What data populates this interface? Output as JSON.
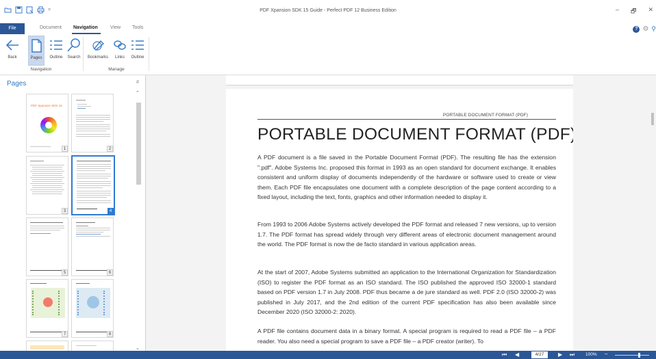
{
  "window": {
    "title": "PDF Xpansion SDK 15 Guide - Perfect PDF 12 Business Edition"
  },
  "quick_access": [
    "open-icon",
    "save-icon",
    "save-as-icon",
    "print-icon",
    "customize-icon"
  ],
  "tabs": [
    {
      "label": "File"
    },
    {
      "label": "Document"
    },
    {
      "label": "Navigation"
    },
    {
      "label": "View"
    },
    {
      "label": "Tools"
    }
  ],
  "ribbon": {
    "navigation_group": {
      "label": "Navigation",
      "buttons": [
        {
          "label": "Back",
          "icon": "back-arrow-icon"
        },
        {
          "label": "Pages",
          "icon": "pages-icon"
        },
        {
          "label": "Outline",
          "icon": "outline-icon"
        },
        {
          "label": "Search",
          "icon": "search-icon"
        }
      ]
    },
    "manage_group": {
      "label": "Manage",
      "buttons": [
        {
          "label": "Bookmarks",
          "icon": "bookmark-icon"
        },
        {
          "label": "Links",
          "icon": "link-icon"
        },
        {
          "label": "Outline",
          "icon": "outline-icon"
        }
      ]
    }
  },
  "pages_panel": {
    "title": "Pages",
    "pin_glyph": "#",
    "thumbnails": [
      {
        "number": "1",
        "heading": "PDF Xpansion SDK 15"
      },
      {
        "number": "2"
      },
      {
        "number": "3"
      },
      {
        "number": "4",
        "selected": true
      },
      {
        "number": "5"
      },
      {
        "number": "6"
      },
      {
        "number": "7"
      },
      {
        "number": "8"
      }
    ]
  },
  "document": {
    "running_header": "PORTABLE DOCUMENT FORMAT (PDF)",
    "title": "PORTABLE DOCUMENT FORMAT (PDF)",
    "paragraphs": [
      "A PDF document is a file saved in the Portable Document Format (PDF). The resulting file has the extension \".pdf\". Adobe Systems Inc. proposed this format in 1993 as an open standard for document exchange. It enables consistent and uniform display of documents independently of the hardware or software used to create or view them. Each PDF file encapsulates one document with a complete description of the page content according to a fixed layout, including the text, fonts, graphics and other information needed to display it.",
      "From 1993 to 2006 Adobe Systems actively developed the PDF format and released 7 new versions, up to version 1.7. The PDF format has spread widely through very different areas of electronic document management around the world. The PDF format is now the de facto standard in various application areas.",
      "At the start of 2007, Adobe Systems submitted an application to the International Organization for Standardization (ISO) to register the PDF format as an ISO standard. The ISO published the approved ISO 32000-1 standard based on PDF version 1.7 in July 2008. PDF thus became a de jure standard as well. PDF 2.0 (ISO 32000-2) was published in July 2017, and the 2nd edition of the current PDF specification has also been available since December 2020 (ISO 32000-2: 2020).",
      "A PDF file contains document data in a binary format. A special program is required to read a PDF file – a PDF reader. You also need a special program to save a PDF file – a PDF creator (writer). To"
    ]
  },
  "statusbar": {
    "page_indicator": "4/27",
    "zoom": "100%",
    "zoom_level_fraction": 0.72
  },
  "colors": {
    "accent": "#2b5797",
    "link": "#2b79c2",
    "selection": "#2f7bd0"
  }
}
